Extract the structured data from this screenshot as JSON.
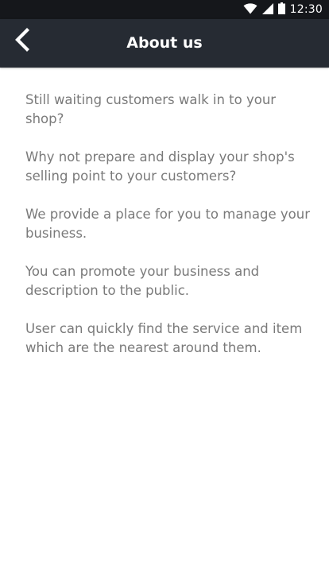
{
  "status_bar": {
    "time": "12:30",
    "icons": [
      "wifi-icon",
      "signal-icon",
      "battery-icon"
    ]
  },
  "app_bar": {
    "title": "About us",
    "back_icon": "chevron-left-icon",
    "background_color": "#262b33"
  },
  "content": {
    "paragraphs": [
      "Still waiting customers walk in to your shop?",
      "Why not prepare and display your shop's selling point to your customers?",
      "We provide a place for you to manage your business.",
      "You can promote your business and description to the public.",
      "User can quickly find the service and item which are the nearest around them."
    ],
    "text_color": "#7a7a7a"
  }
}
